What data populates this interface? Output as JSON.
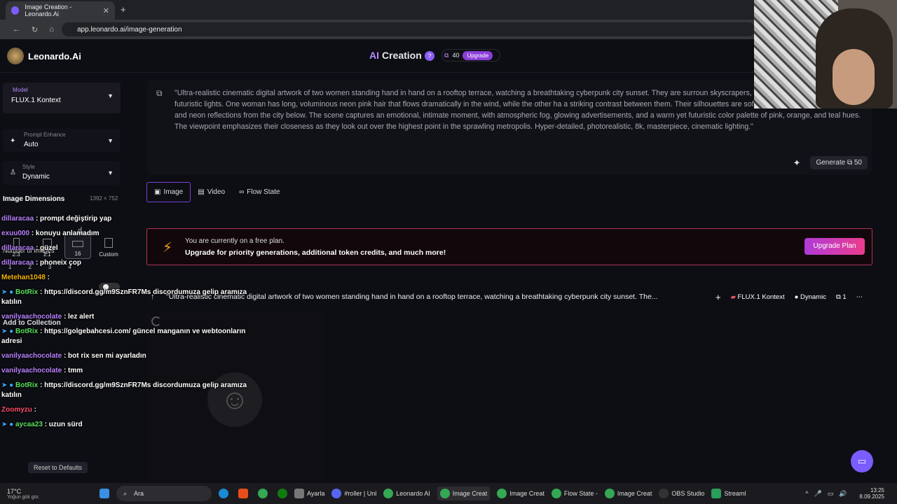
{
  "browser": {
    "tab_title": "Image Creation - Leonardo.Ai",
    "url": "app.leonardo.ai/image-generation"
  },
  "header": {
    "logo": "Leonardo.Ai",
    "title_ai": "AI",
    "title_rest": "Creation",
    "tokens": "40",
    "upgrade": "Upgrade"
  },
  "sidebar": {
    "model_label": "Model",
    "model_value": "FLUX.1 Kontext",
    "enhance_label": "Prompt Enhance",
    "enhance_value": "Auto",
    "style_label": "Style",
    "style_value": "Dynamic",
    "dims_title": "Image Dimensions",
    "dims_size": "1392 × 752",
    "dims": [
      {
        "label": "2:3"
      },
      {
        "label": "1:1"
      },
      {
        "label": "16"
      },
      {
        "label": "Custom"
      }
    ],
    "num_images": "Number of images",
    "num_options": [
      "1",
      "2",
      "3",
      "4"
    ],
    "collection": "Add to Collection",
    "reset": "Reset to Defaults"
  },
  "prompt": {
    "text": "\"Ultra-realistic cinematic digital artwork of two women standing hand in hand on a rooftop terrace, watching a breathtaking cyberpunk city sunset. They are surroun skyscrapers, glowing holograms, and vibrant futuristic lights. One woman has long, voluminous neon pink hair that flows dramatically in the wind, while the other ha a striking contrast between them. Their silhouettes are softly illuminated by the setting sun and neon reflections from the city below. The scene captures an emotional, intimate moment, with atmospheric fog, glowing advertisements, and a warm yet futuristic color palette of pink, orange, and teal hues. The viewpoint emphasizes their closeness as they look out over the highest point in the sprawling metropolis. Hyper-detailed, photorealistic, 8k, masterpiece, cinematic lighting.\"",
    "generate": "Generate",
    "cost": "50"
  },
  "tabs": [
    "Image",
    "Video",
    "Flow State"
  ],
  "banner": {
    "line1": "You are currently on a free plan.",
    "line2": "Upgrade for priority generations, additional token credits, and much more!",
    "button": "Upgrade Plan"
  },
  "generation": {
    "prompt": "\"Ultra-realistic cinematic digital artwork of two women standing hand in hand on a rooftop terrace, watching a breathtaking cyberpunk city sunset. The...",
    "model": "FLUX.1 Kontext",
    "style": "Dynamic",
    "count": "1"
  },
  "chat": [
    {
      "user": "dillaracaa",
      "type": "u",
      "msg": ": prompt değiştirip yap"
    },
    {
      "user": "exuu000",
      "type": "u",
      "msg": ": konuyu anlamadım"
    },
    {
      "user": "dillaracaa",
      "type": "u",
      "msg": ": güzel"
    },
    {
      "user": "dillaracaa",
      "type": "u",
      "msg": ": phoneix çop"
    },
    {
      "user": "Metehan1048",
      "type": "u",
      "msg": ":"
    },
    {
      "user": "BotRix",
      "type": "b",
      "msg": ": https://discord.gg/m9SznFR7Ms discordumuza gelip aramıza katılın"
    },
    {
      "user": "vanilyaachocolate",
      "type": "u",
      "msg": ": lez alert"
    },
    {
      "user": "BotRix",
      "type": "b",
      "msg": ": https://golgebahcesi.com/ güncel manganın ve webtoonların adresi"
    },
    {
      "user": "vanilyaachocolate",
      "type": "u",
      "msg": ": bot rix sen mi ayarladın"
    },
    {
      "user": "vanilyaachocolate",
      "type": "u",
      "msg": ": tmm"
    },
    {
      "user": "BotRix",
      "type": "b",
      "msg": ": https://discord.gg/m9SznFR7Ms discordumuza gelip aramıza katılın"
    },
    {
      "user": "Zoomyzu",
      "type": "z",
      "msg": ":"
    },
    {
      "user": "aycaa23",
      "type": "b",
      "msg": ": uzun sürd"
    }
  ],
  "taskbar": {
    "weather": "17°C",
    "weather_sub": "Yoğun gök gür.",
    "search": "Ara",
    "apps": [
      "Ayarla",
      "#roller | Unl",
      "Leonardo AI",
      "Image Creat",
      "Image Creat",
      "Flow State -",
      "Image Creat",
      "OBS Studio",
      "Streaml"
    ],
    "time": "13:25",
    "date": "8.09.2025"
  }
}
